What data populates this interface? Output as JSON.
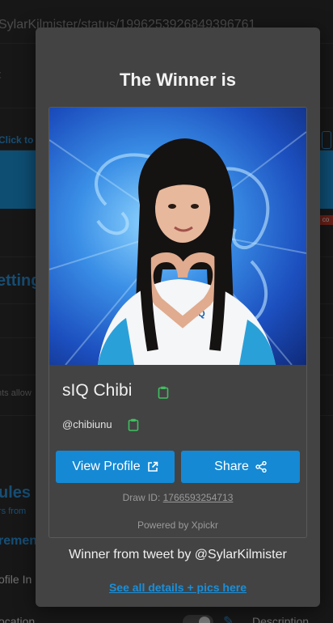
{
  "background": {
    "url_text": "SylarKilmister/status/1996253926849396761",
    "click_text": "Click to",
    "settings_text": "etting",
    "badge_text": "co",
    "allow_text": "nts allow",
    "rules_text": "ules",
    "rules_sub": "rs from",
    "requirements_text": "remen",
    "profile_text": "ofile In",
    "location_text": "ocation",
    "description_text": "Description"
  },
  "modal": {
    "title": "The Winner is",
    "winner_name": "sIQ Chibi",
    "winner_handle": "@chibiunu",
    "view_profile_label": "View Profile",
    "share_label": "Share",
    "draw_id_label": "Draw ID:",
    "draw_id_value": "1766593254713",
    "powered_by": "Powered by Xpickr",
    "tweet_line": "Winner from tweet by @SylarKilmister",
    "details_link": "See all details + pics here"
  },
  "colors": {
    "accent": "#1589d4",
    "copy_icon": "#3fbf5f",
    "modal_bg": "#434343"
  },
  "icons": {
    "copy": "clipboard-icon",
    "external": "external-link-icon",
    "share": "share-nodes-icon"
  }
}
